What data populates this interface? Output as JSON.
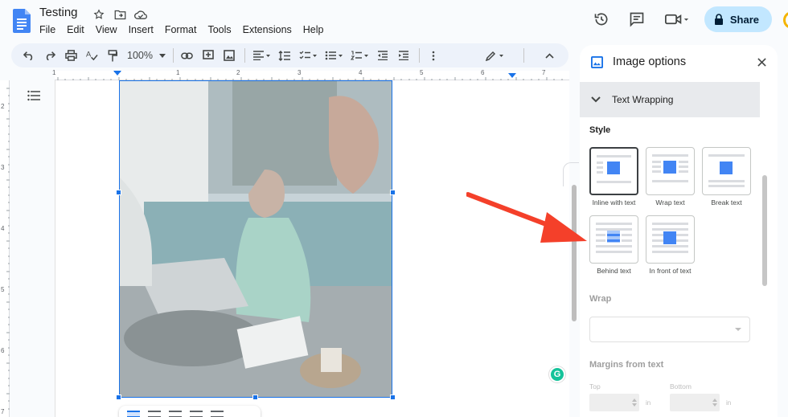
{
  "app": {
    "doc_title": "Testing",
    "menu": [
      "File",
      "Edit",
      "View",
      "Insert",
      "Format",
      "Tools",
      "Extensions",
      "Help"
    ],
    "share_label": "Share",
    "accent_color": "#1a73e8"
  },
  "toolbar": {
    "zoom": "100%"
  },
  "ruler": {
    "h_numbers": [
      "1",
      "1",
      "2",
      "3",
      "4",
      "5",
      "6",
      "7"
    ],
    "v_numbers": [
      "2",
      "3",
      "4",
      "5",
      "6",
      "7"
    ]
  },
  "panel": {
    "title": "Image options",
    "section": "Text Wrapping",
    "style_label": "Style",
    "options": [
      {
        "label": "Inline with text",
        "selected": true
      },
      {
        "label": "Wrap text",
        "selected": false
      },
      {
        "label": "Break text",
        "selected": false
      },
      {
        "label": "Behind text",
        "selected": false
      },
      {
        "label": "In front of text",
        "selected": false
      }
    ],
    "wrap_label": "Wrap",
    "margins_label": "Margins from text",
    "top_label": "Top",
    "bottom_label": "Bottom",
    "unit_top": "in",
    "unit_bottom": "in"
  },
  "annotation": {
    "arrow_color": "#f4402a"
  }
}
